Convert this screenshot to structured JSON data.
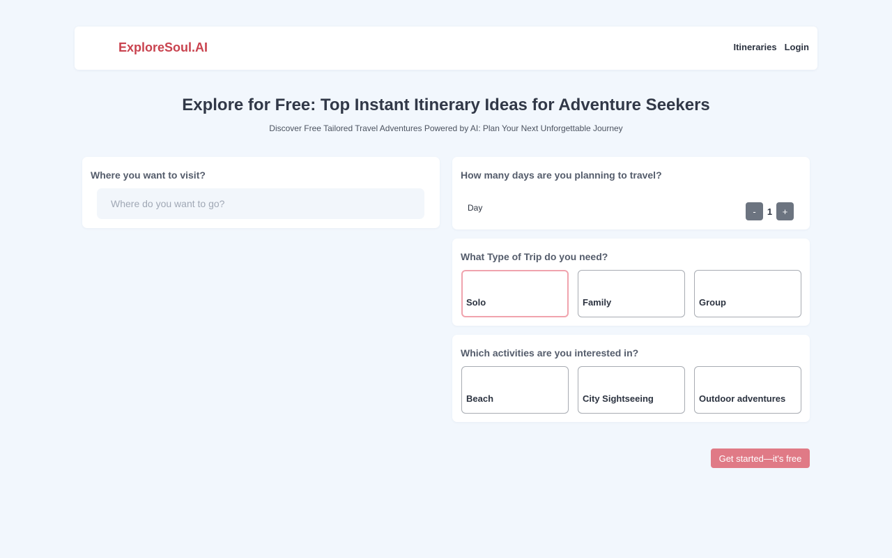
{
  "header": {
    "brand": "ExploreSoul.AI",
    "nav": [
      "Itineraries",
      "Login"
    ]
  },
  "hero": {
    "title": "Explore for Free: Top Instant Itinerary Ideas for Adventure Seekers",
    "subtitle": "Discover Free Tailored Travel Adventures Powered by AI: Plan Your Next Unforgettable Journey"
  },
  "destination": {
    "question": "Where you want to visit?",
    "placeholder": "Where do you want to go?",
    "value": ""
  },
  "days": {
    "question": "How many days are you planning to travel?",
    "unit_label": "Day",
    "decrement_label": "-",
    "value": "1",
    "increment_label": "+"
  },
  "trip_type": {
    "question": "What Type of Trip do you need?",
    "options": [
      "Solo",
      "Family",
      "Group"
    ],
    "selected": "Solo"
  },
  "activities": {
    "question": "Which activities are you interested in?",
    "options": [
      "Beach",
      "City Sightseeing",
      "Outdoor adventures"
    ]
  },
  "cta": {
    "label": "Get started—it's free"
  },
  "colors": {
    "background": "#f2f7fd",
    "brand": "#c9434f",
    "cta": "#e07a86",
    "selected_border": "#f0a3ad",
    "stepper": "#6c7480"
  }
}
